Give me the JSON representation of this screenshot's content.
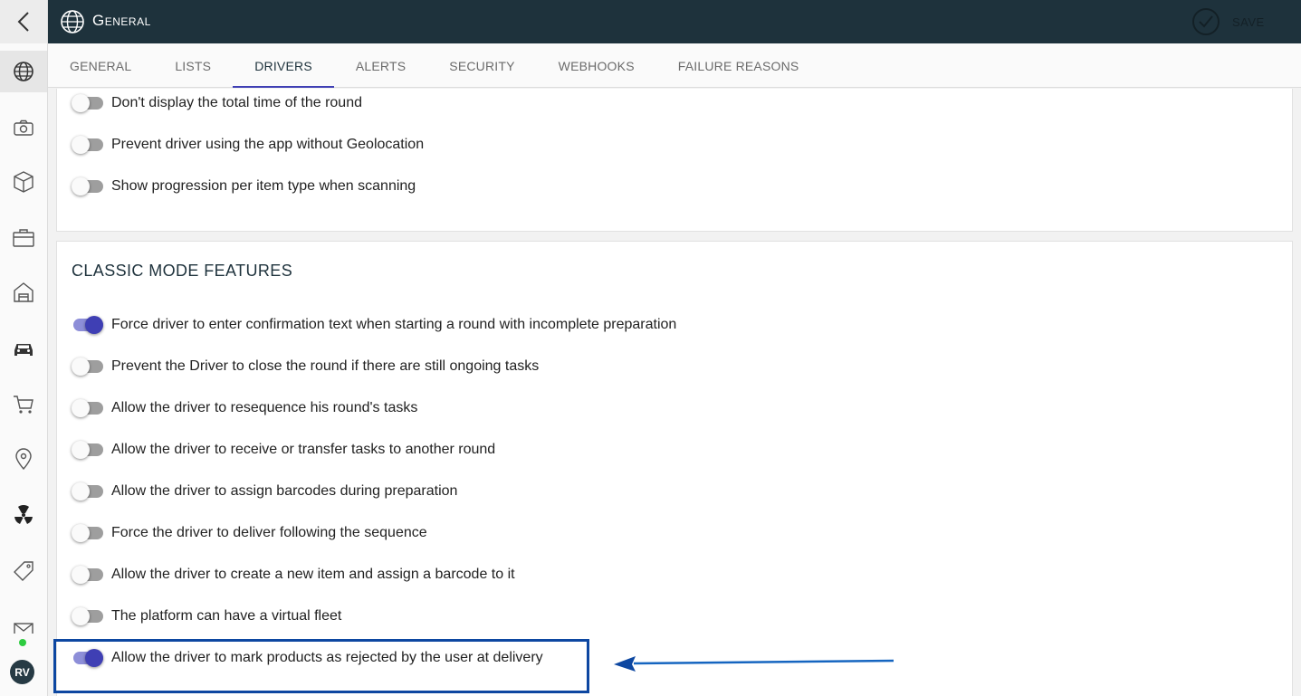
{
  "header": {
    "title": "General",
    "save_label": "SAVE"
  },
  "tabs": [
    {
      "label": "GENERAL"
    },
    {
      "label": "LISTS"
    },
    {
      "label": "DRIVERS"
    },
    {
      "label": "ALERTS"
    },
    {
      "label": "SECURITY"
    },
    {
      "label": "WEBHOOKS"
    },
    {
      "label": "FAILURE REASONS"
    }
  ],
  "active_tab": "DRIVERS",
  "sidebar": {
    "items": [
      {
        "icon": "globe-icon"
      },
      {
        "icon": "camera-icon"
      },
      {
        "icon": "box-icon"
      },
      {
        "icon": "briefcase-icon"
      },
      {
        "icon": "warehouse-icon"
      },
      {
        "icon": "car-icon"
      },
      {
        "icon": "cart-icon"
      },
      {
        "icon": "map-pin-icon"
      },
      {
        "icon": "hazard-icon"
      },
      {
        "icon": "tag-icon"
      },
      {
        "icon": "mail-icon"
      }
    ],
    "avatar_initials": "RV",
    "status": "online"
  },
  "top_section": {
    "toggles": [
      {
        "label": "Don't display the total time of the round",
        "on": false
      },
      {
        "label": "Prevent driver using the app without Geolocation",
        "on": false
      },
      {
        "label": "Show progression per item type when scanning",
        "on": false
      }
    ]
  },
  "classic_mode": {
    "title": "CLASSIC MODE FEATURES",
    "toggles": [
      {
        "label": "Force driver to enter confirmation text when starting a round with incomplete preparation",
        "on": true
      },
      {
        "label": "Prevent the Driver to close the round if there are still ongoing tasks",
        "on": false
      },
      {
        "label": "Allow the driver to resequence his round's tasks",
        "on": false
      },
      {
        "label": "Allow the driver to receive or transfer tasks to another round",
        "on": false
      },
      {
        "label": "Allow the driver to assign barcodes during preparation",
        "on": false
      },
      {
        "label": "Force the driver to deliver following the sequence",
        "on": false
      },
      {
        "label": "Allow the driver to create a new item and assign a barcode to it",
        "on": false
      },
      {
        "label": "The platform can have a virtual fleet",
        "on": false
      },
      {
        "label": "Allow the driver to mark products as rejected by the user at delivery",
        "on": true
      }
    ]
  },
  "colors": {
    "header_bg": "#1e323c",
    "accent": "#3f3fb4",
    "highlight": "#0d47a1"
  }
}
